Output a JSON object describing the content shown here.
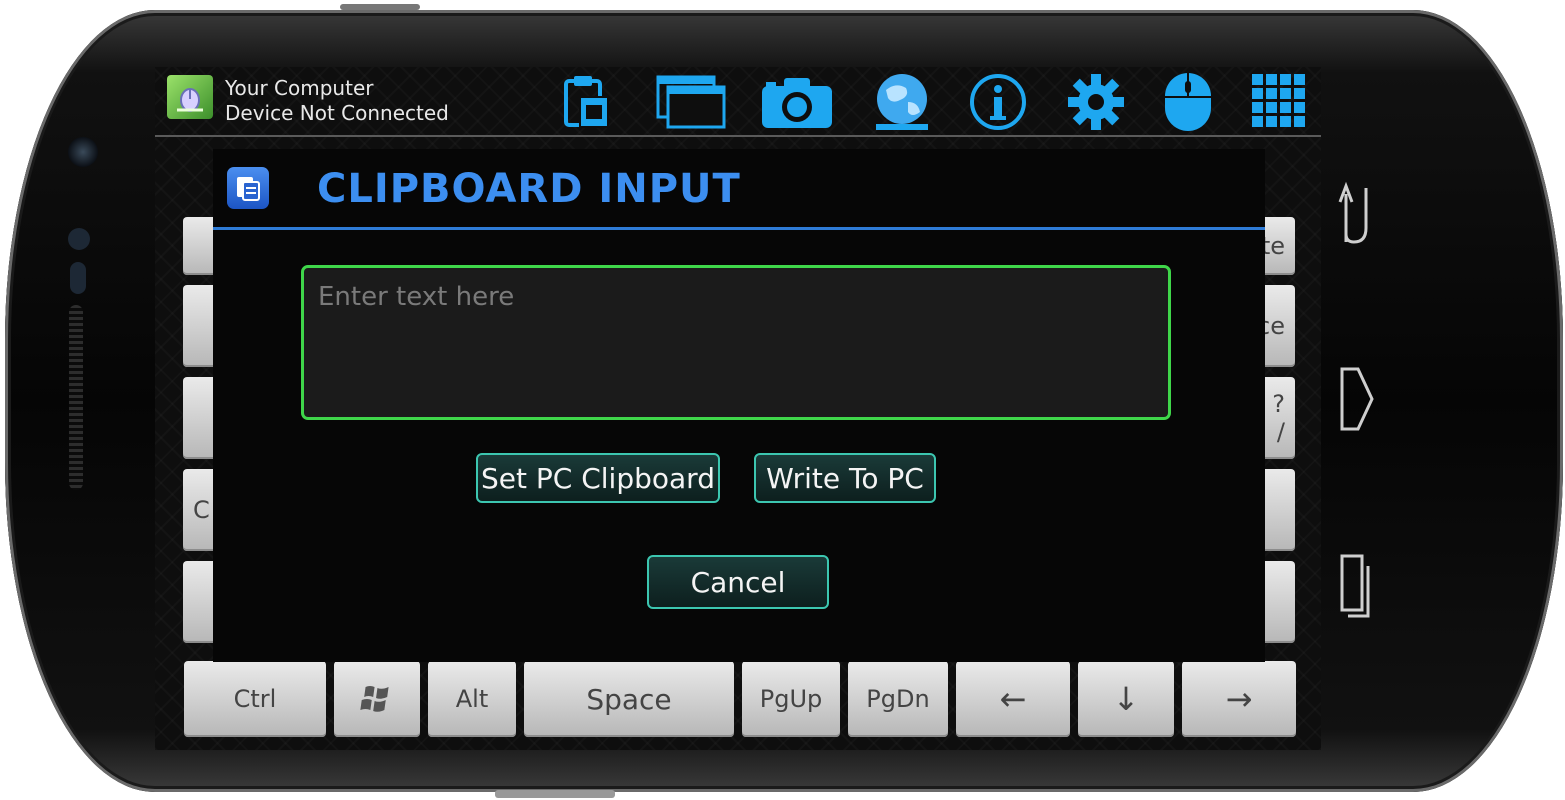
{
  "status": {
    "line1": "Your Computer",
    "line2": "Device Not Connected"
  },
  "toolbar": {
    "icons": [
      "clipboard-icon",
      "windows-icon",
      "camera-icon",
      "globe-icon",
      "info-icon",
      "gear-icon",
      "mouse-icon",
      "grid-icon"
    ]
  },
  "dialog": {
    "title": "CLIPBOARD INPUT",
    "placeholder": "Enter text here",
    "set_clipboard": "Set PC Clipboard",
    "write_to_pc": "Write To PC",
    "cancel": "Cancel"
  },
  "keyboard": {
    "bottom_row": [
      "Ctrl",
      "",
      "Alt",
      "Space",
      "PgUp",
      "PgDn",
      "←",
      "↓",
      "→"
    ],
    "partial_right": [
      "te",
      "ce",
      "?",
      "/"
    ],
    "partial_left": [
      "C"
    ]
  },
  "colors": {
    "accent": "#3c8ef0",
    "input_border": "#3fd64a",
    "button_border": "#3cc6b0",
    "icon_blue": "#1ea7f0"
  }
}
